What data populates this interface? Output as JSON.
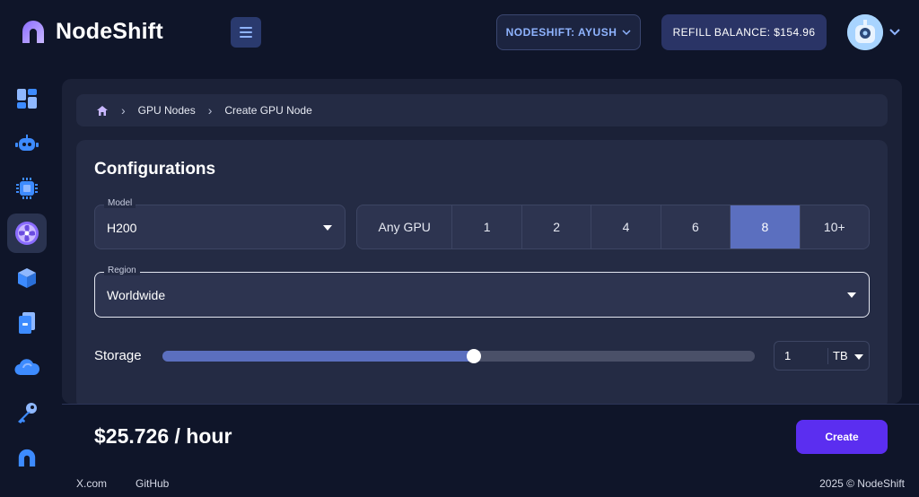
{
  "brand": {
    "name": "NodeShift",
    "accent": "#5b2ef0",
    "selected": "#5b6fbf"
  },
  "header": {
    "org_label": "NODESHIFT: AYUSH",
    "refill_label": "REFILL BALANCE:",
    "refill_amount": "$154.96"
  },
  "sidebar": {
    "items": [
      {
        "icon": "dashboard-icon",
        "active": false
      },
      {
        "icon": "robot-icon",
        "active": false
      },
      {
        "icon": "chip-icon",
        "active": false
      },
      {
        "icon": "gpu-fan-icon",
        "active": true
      },
      {
        "icon": "cube-icon",
        "active": false
      },
      {
        "icon": "storage-icon",
        "active": false
      },
      {
        "icon": "cloud-icon",
        "active": false
      },
      {
        "icon": "key-icon",
        "active": false
      },
      {
        "icon": "nodeshift-mark-icon",
        "active": false
      }
    ]
  },
  "breadcrumb": {
    "items": [
      "GPU Nodes",
      "Create GPU Node"
    ]
  },
  "config": {
    "title": "Configurations",
    "model": {
      "label": "Model",
      "value": "H200"
    },
    "gpu_count": {
      "options": [
        "Any GPU",
        "1",
        "2",
        "4",
        "6",
        "8",
        "10+"
      ],
      "selected": "8"
    },
    "region": {
      "label": "Region",
      "value": "Worldwide"
    },
    "storage": {
      "label": "Storage",
      "value": "1",
      "unit": "TB",
      "slider_fraction": 0.525
    }
  },
  "footer_bar": {
    "price": "$25.726 / hour",
    "create_label": "Create"
  },
  "footer": {
    "links": [
      "X.com",
      "GitHub"
    ],
    "copyright": "2025 © NodeShift"
  }
}
